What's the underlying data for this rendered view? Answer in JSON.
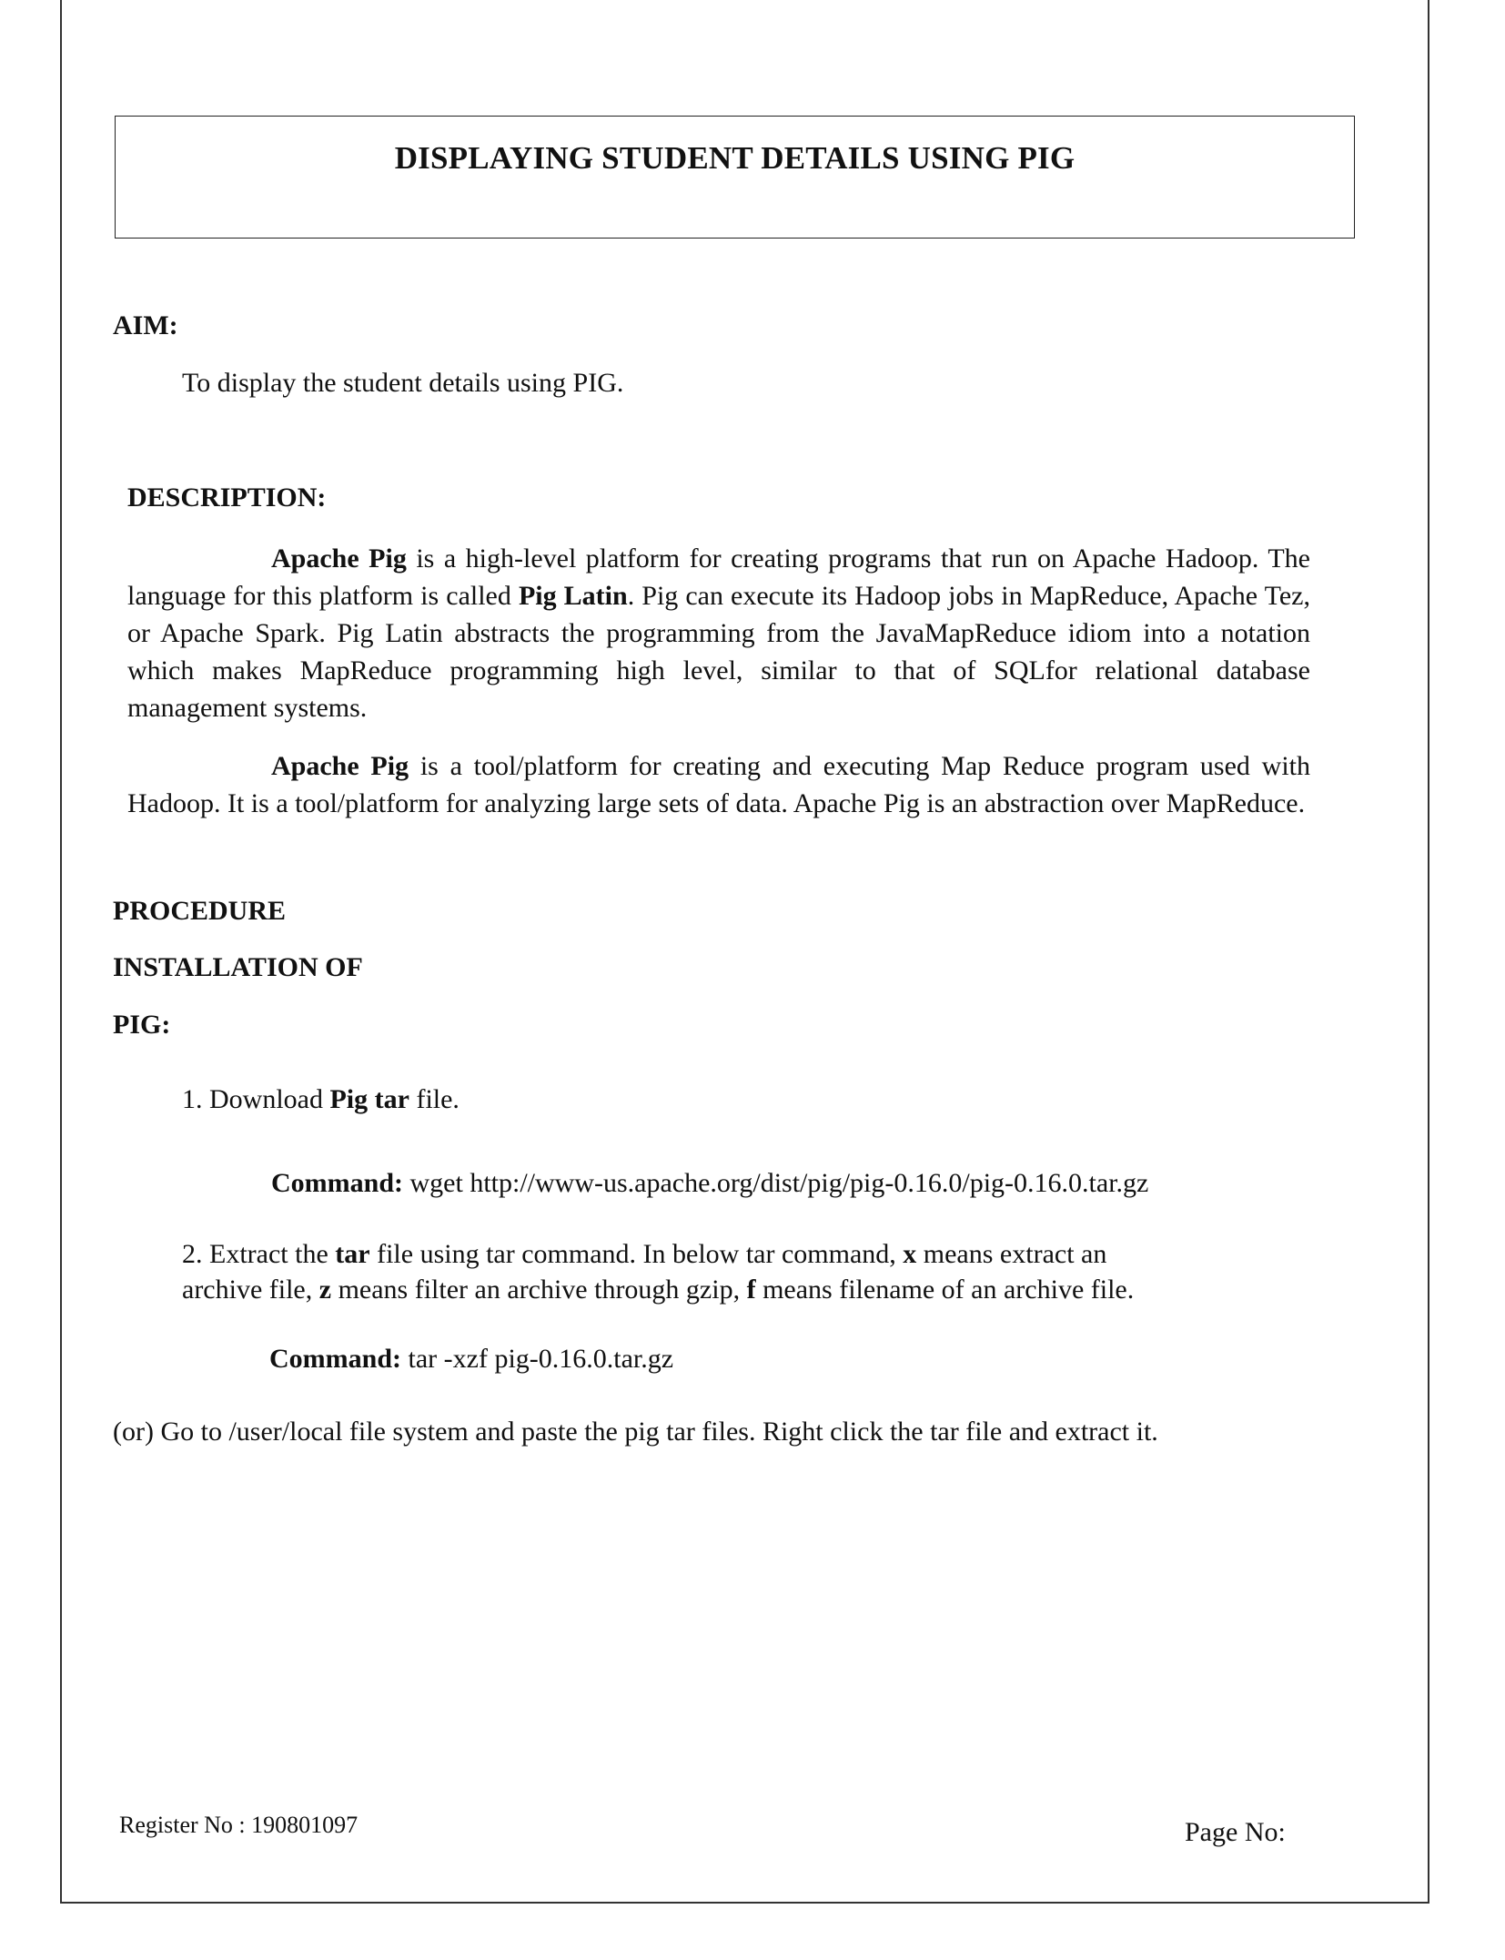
{
  "title": "DISPLAYING STUDENT DETAILS USING PIG",
  "aim": {
    "heading": "AIM:",
    "text": "To display the student details using PIG."
  },
  "description": {
    "heading": "DESCRIPTION:",
    "p1": {
      "b1": "Apache Pig",
      "t1": " is a high-level platform for creating programs that run on Apache Hadoop. The language for this platform is called ",
      "b2": "Pig Latin",
      "t2": ". Pig can execute its Hadoop jobs in MapReduce, Apache Tez, or Apache Spark. Pig Latin abstracts the programming from the JavaMapReduce idiom into a notation which makes MapReduce programming high level, similar to that of SQLfor relational database management systems."
    },
    "p2": {
      "b1": "Apache Pig",
      "t1": " is a tool/platform for creating and executing Map Reduce program used with Hadoop. It is a tool/platform for analyzing large sets of data. Apache Pig is an abstraction over MapReduce."
    }
  },
  "procedure": {
    "heading": "PROCEDURE",
    "sub1": "INSTALLATION OF",
    "sub2": "PIG:",
    "step1": {
      "num": "1. Download ",
      "b1": "Pig tar",
      "t1": " file."
    },
    "command1": {
      "label": "Command:",
      "value": " wget http://www-us.apache.org/dist/pig/pig-0.16.0/pig-0.16.0.tar.gz"
    },
    "step2": {
      "num": "2.  Extract the ",
      "b1": "tar",
      "t1": " file using tar command. In below tar command, ",
      "b2": "x",
      "t2": " means extract an",
      "line2a": "archive file, ",
      "b3": "z",
      "t3": " means filter an archive through gzip, ",
      "b4": "f",
      "t4": " means filename of an archive file."
    },
    "command2": {
      "label": "Command:",
      "value": " tar -xzf pig-0.16.0.tar.gz"
    },
    "alternative": "(or) Go to /user/local file system and paste the pig tar files. Right click the tar file and extract it."
  },
  "footer": {
    "register": "Register No : 190801097",
    "page": "Page No:"
  }
}
